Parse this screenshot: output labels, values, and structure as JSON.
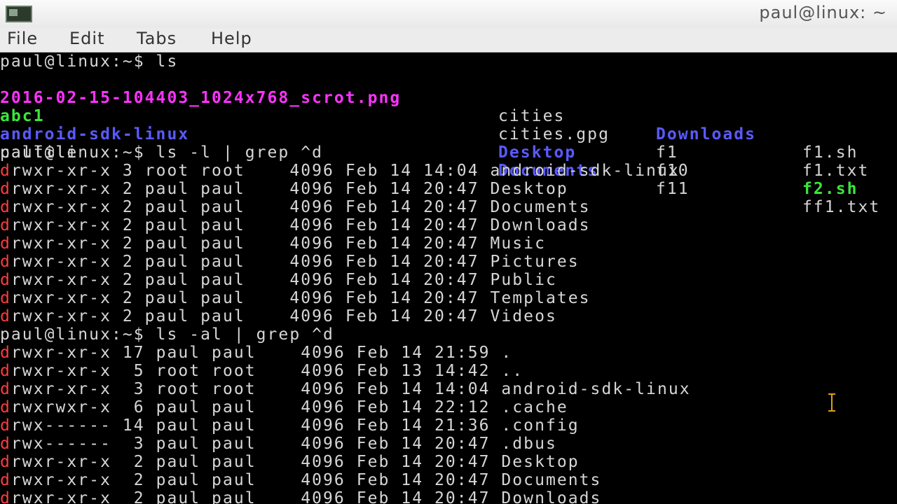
{
  "window": {
    "title": "paul@linux: ~"
  },
  "menu": [
    "File",
    "Edit",
    "Tabs",
    "Help"
  ],
  "colors": {
    "directory": "#5a5aff",
    "executable": "#3be63b",
    "image": "#ff32ff",
    "perm_d": "#ff3b3b"
  },
  "terminal": {
    "prompt1": "paul@linux:~$ ls",
    "ls_rows": [
      [
        "2016-02-15-104403_1024x768_scrot.png",
        "cities",
        "Downloads",
        "f1.sh"
      ],
      [
        "abc1",
        "cities.gpg",
        "f1",
        "f1.txt"
      ],
      [
        "android-sdk-linux",
        "Desktop",
        "f10",
        "f2.sh"
      ],
      [
        "calfile",
        "Documents",
        "f11",
        "ff1.txt"
      ]
    ],
    "prompt2": "paul@linux:~$ ls -l | grep ^d",
    "grep1_rows": [
      [
        "d",
        "rwxr-xr-x 3 root root    4096 Feb 14 14:04 android-sdk-linux"
      ],
      [
        "d",
        "rwxr-xr-x 2 paul paul    4096 Feb 14 20:47 Desktop"
      ],
      [
        "d",
        "rwxr-xr-x 2 paul paul    4096 Feb 14 20:47 Documents"
      ],
      [
        "d",
        "rwxr-xr-x 2 paul paul    4096 Feb 14 20:47 Downloads"
      ],
      [
        "d",
        "rwxr-xr-x 2 paul paul    4096 Feb 14 20:47 Music"
      ],
      [
        "d",
        "rwxr-xr-x 2 paul paul    4096 Feb 14 20:47 Pictures"
      ],
      [
        "d",
        "rwxr-xr-x 2 paul paul    4096 Feb 14 20:47 Public"
      ],
      [
        "d",
        "rwxr-xr-x 2 paul paul    4096 Feb 14 20:47 Templates"
      ],
      [
        "d",
        "rwxr-xr-x 2 paul paul    4096 Feb 14 20:47 Videos"
      ]
    ],
    "prompt3": "paul@linux:~$ ls -al | grep ^d",
    "grep2_rows": [
      [
        "d",
        "rwxr-xr-x 17 paul paul    4096 Feb 14 21:59 ."
      ],
      [
        "d",
        "rwxr-xr-x  5 root root    4096 Feb 13 14:42 .."
      ],
      [
        "d",
        "rwxr-xr-x  3 root root    4096 Feb 14 14:04 android-sdk-linux"
      ],
      [
        "d",
        "rwxrwxr-x  6 paul paul    4096 Feb 14 22:12 .cache"
      ],
      [
        "d",
        "rwx------ 14 paul paul    4096 Feb 14 21:36 .config"
      ],
      [
        "d",
        "rwx------  3 paul paul    4096 Feb 14 20:47 .dbus"
      ],
      [
        "d",
        "rwxr-xr-x  2 paul paul    4096 Feb 14 20:47 Desktop"
      ],
      [
        "d",
        "rwxr-xr-x  2 paul paul    4096 Feb 14 20:47 Documents"
      ],
      [
        "d",
        "rwxr-xr-x  2 paul paul    4096 Feb 14 20:47 Downloads"
      ]
    ]
  }
}
